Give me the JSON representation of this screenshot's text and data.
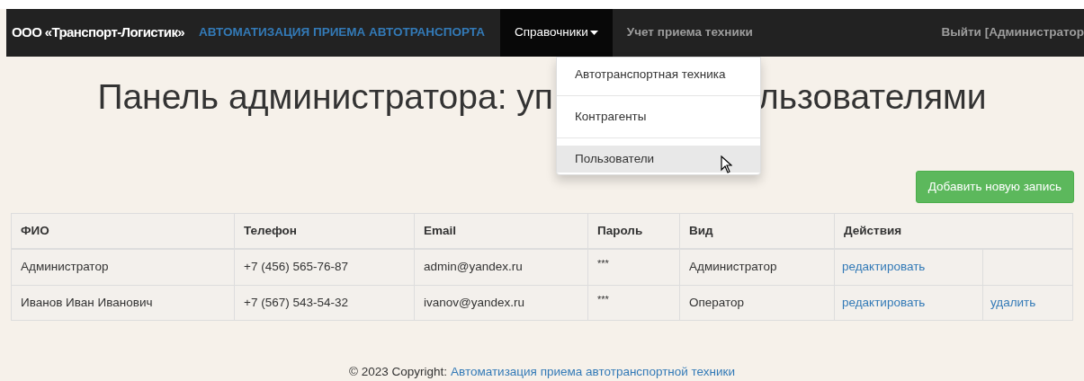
{
  "navbar": {
    "brand": "ООО «Транспорт-Логистик»",
    "app_title": "АВТОМАТИЗАЦИЯ ПРИЕМА АВТОТРАНСПОРТА",
    "items": [
      {
        "label": "Справочники",
        "selected": true,
        "kind": "dropdown"
      },
      {
        "label": "Учет приема техники",
        "selected": false,
        "kind": "link"
      }
    ],
    "logout": "Выйти [Администратор"
  },
  "dropdown": {
    "items": [
      {
        "label": "Автотранспортная техника",
        "selected": false
      },
      {
        "label": "Контрагенты",
        "selected": false
      },
      {
        "label": "Пользователи",
        "selected": true
      }
    ]
  },
  "heading": {
    "parts": [
      "Панель администратора: уп",
      "льзователями"
    ]
  },
  "add_button": "Добавить новую запись",
  "table": {
    "columns": [
      "ФИО",
      "Телефон",
      "Email",
      "Пароль",
      "Вид",
      "Действия"
    ],
    "rows": [
      {
        "cells": [
          "Администратор",
          "+7 (456) 565-76-87",
          "admin@yandex.ru",
          "***",
          "Администратор"
        ],
        "actions": [
          "редактировать"
        ]
      },
      {
        "cells": [
          "Иванов Иван Иванович",
          "+7 (567) 543-54-32",
          "ivanov@yandex.ru",
          "***",
          "Оператор"
        ],
        "actions": [
          "редактировать",
          "удалить"
        ]
      }
    ]
  },
  "footer": {
    "text": "© 2023 Copyright:",
    "link": "Автоматизация приема автотранспортной техники"
  }
}
